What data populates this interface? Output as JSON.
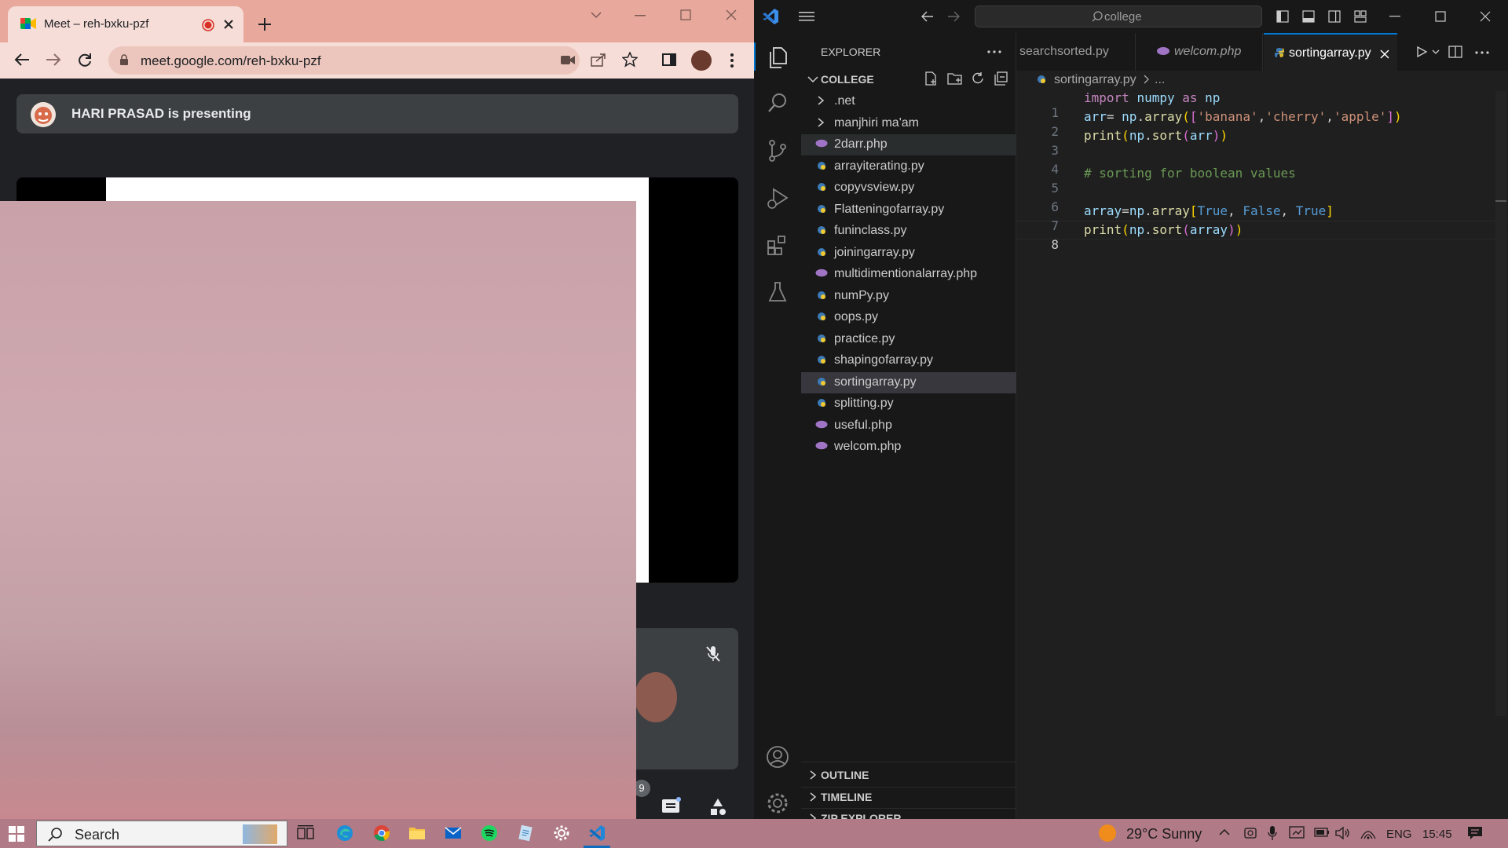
{
  "chrome": {
    "tab_title": "Meet – reh-bxku-pzf",
    "url": "meet.google.com/reh-bxku-pzf",
    "presenting_text": "HARI PRASAD is presenting",
    "participant_count": "9"
  },
  "vscode": {
    "search_text": "college",
    "explorer_title": "EXPLORER",
    "folder_name": "COLLEGE",
    "folders": [
      ".net",
      "manjhiri ma'am"
    ],
    "files": [
      {
        "name": "2darr.php",
        "type": "php"
      },
      {
        "name": "arrayiterating.py",
        "type": "py"
      },
      {
        "name": "copyvsview.py",
        "type": "py"
      },
      {
        "name": "Flatteningofarray.py",
        "type": "py"
      },
      {
        "name": "funinclass.py",
        "type": "py"
      },
      {
        "name": "joiningarray.py",
        "type": "py"
      },
      {
        "name": "multidimentionalarray.php",
        "type": "php"
      },
      {
        "name": "numPy.py",
        "type": "py"
      },
      {
        "name": "oops.py",
        "type": "py"
      },
      {
        "name": "practice.py",
        "type": "py"
      },
      {
        "name": "shapingofarray.py",
        "type": "py"
      },
      {
        "name": "sortingarray.py",
        "type": "py",
        "selected": true
      },
      {
        "name": "splitting.py",
        "type": "py"
      },
      {
        "name": "useful.php",
        "type": "php"
      },
      {
        "name": "welcom.php",
        "type": "php"
      }
    ],
    "tabs": [
      {
        "label": "searchsorted.py",
        "active": false
      },
      {
        "label": "welcom.php",
        "active": false
      },
      {
        "label": "sortingarray.py",
        "active": true
      }
    ],
    "breadcrumb_file": "sortingarray.py",
    "breadcrumb_more": "...",
    "line_numbers": [
      "1",
      "2",
      "3",
      "4",
      "5",
      "6",
      "7",
      "8"
    ],
    "code": {
      "l1a": "import",
      "l1b": "numpy",
      "l1c": "as",
      "l1d": "np",
      "l2a": "arr",
      "l2b": "= ",
      "l2c": "np",
      "l2d": ".",
      "l2e": "array",
      "l2f": "(",
      "l2g": "[",
      "l2h": "'banana'",
      "l2i": ",",
      "l2j": "'cherry'",
      "l2k": ",",
      "l2l": "'apple'",
      "l2m": "]",
      "l2n": ")",
      "l3a": "print",
      "l3b": "(",
      "l3c": "np",
      "l3d": ".",
      "l3e": "sort",
      "l3f": "(",
      "l3g": "arr",
      "l3h": ")",
      "l3i": ")",
      "l5": "# sorting for boolean values",
      "l7a": "array",
      "l7b": "=",
      "l7c": "np",
      "l7d": ".",
      "l7e": "array",
      "l7f": "[",
      "l7g": "True",
      "l7h": ", ",
      "l7i": "False",
      "l7j": ", ",
      "l7k": "True",
      "l7l": "]",
      "l8a": "print",
      "l8b": "(",
      "l8c": "np",
      "l8d": ".",
      "l8e": "sort",
      "l8f": "(",
      "l8g": "array",
      "l8h": ")",
      "l8i": ")"
    },
    "sections": [
      "OUTLINE",
      "TIMELINE",
      "ZIP EXPLORER"
    ]
  },
  "taskbar": {
    "search_placeholder": "Search",
    "weather": "29°C  Sunny",
    "language": "ENG",
    "time": "15:45"
  },
  "colors": {
    "chrome_frame": "#e8a89b",
    "vscode_bg": "#1f1f1f",
    "taskbar": "#b07a86"
  }
}
